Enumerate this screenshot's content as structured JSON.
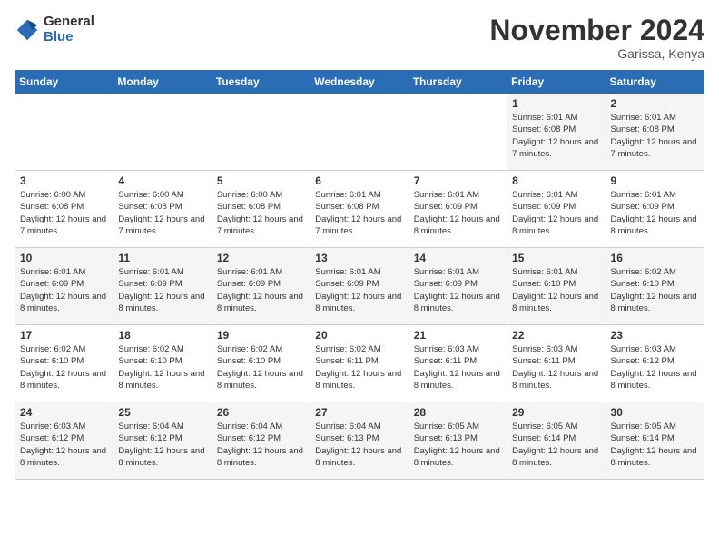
{
  "logo": {
    "general": "General",
    "blue": "Blue"
  },
  "title": "November 2024",
  "location": "Garissa, Kenya",
  "days_of_week": [
    "Sunday",
    "Monday",
    "Tuesday",
    "Wednesday",
    "Thursday",
    "Friday",
    "Saturday"
  ],
  "weeks": [
    [
      {
        "day": "",
        "info": ""
      },
      {
        "day": "",
        "info": ""
      },
      {
        "day": "",
        "info": ""
      },
      {
        "day": "",
        "info": ""
      },
      {
        "day": "",
        "info": ""
      },
      {
        "day": "1",
        "info": "Sunrise: 6:01 AM\nSunset: 6:08 PM\nDaylight: 12 hours and 7 minutes."
      },
      {
        "day": "2",
        "info": "Sunrise: 6:01 AM\nSunset: 6:08 PM\nDaylight: 12 hours and 7 minutes."
      }
    ],
    [
      {
        "day": "3",
        "info": "Sunrise: 6:00 AM\nSunset: 6:08 PM\nDaylight: 12 hours and 7 minutes."
      },
      {
        "day": "4",
        "info": "Sunrise: 6:00 AM\nSunset: 6:08 PM\nDaylight: 12 hours and 7 minutes."
      },
      {
        "day": "5",
        "info": "Sunrise: 6:00 AM\nSunset: 6:08 PM\nDaylight: 12 hours and 7 minutes."
      },
      {
        "day": "6",
        "info": "Sunrise: 6:01 AM\nSunset: 6:08 PM\nDaylight: 12 hours and 7 minutes."
      },
      {
        "day": "7",
        "info": "Sunrise: 6:01 AM\nSunset: 6:09 PM\nDaylight: 12 hours and 8 minutes."
      },
      {
        "day": "8",
        "info": "Sunrise: 6:01 AM\nSunset: 6:09 PM\nDaylight: 12 hours and 8 minutes."
      },
      {
        "day": "9",
        "info": "Sunrise: 6:01 AM\nSunset: 6:09 PM\nDaylight: 12 hours and 8 minutes."
      }
    ],
    [
      {
        "day": "10",
        "info": "Sunrise: 6:01 AM\nSunset: 6:09 PM\nDaylight: 12 hours and 8 minutes."
      },
      {
        "day": "11",
        "info": "Sunrise: 6:01 AM\nSunset: 6:09 PM\nDaylight: 12 hours and 8 minutes."
      },
      {
        "day": "12",
        "info": "Sunrise: 6:01 AM\nSunset: 6:09 PM\nDaylight: 12 hours and 8 minutes."
      },
      {
        "day": "13",
        "info": "Sunrise: 6:01 AM\nSunset: 6:09 PM\nDaylight: 12 hours and 8 minutes."
      },
      {
        "day": "14",
        "info": "Sunrise: 6:01 AM\nSunset: 6:09 PM\nDaylight: 12 hours and 8 minutes."
      },
      {
        "day": "15",
        "info": "Sunrise: 6:01 AM\nSunset: 6:10 PM\nDaylight: 12 hours and 8 minutes."
      },
      {
        "day": "16",
        "info": "Sunrise: 6:02 AM\nSunset: 6:10 PM\nDaylight: 12 hours and 8 minutes."
      }
    ],
    [
      {
        "day": "17",
        "info": "Sunrise: 6:02 AM\nSunset: 6:10 PM\nDaylight: 12 hours and 8 minutes."
      },
      {
        "day": "18",
        "info": "Sunrise: 6:02 AM\nSunset: 6:10 PM\nDaylight: 12 hours and 8 minutes."
      },
      {
        "day": "19",
        "info": "Sunrise: 6:02 AM\nSunset: 6:10 PM\nDaylight: 12 hours and 8 minutes."
      },
      {
        "day": "20",
        "info": "Sunrise: 6:02 AM\nSunset: 6:11 PM\nDaylight: 12 hours and 8 minutes."
      },
      {
        "day": "21",
        "info": "Sunrise: 6:03 AM\nSunset: 6:11 PM\nDaylight: 12 hours and 8 minutes."
      },
      {
        "day": "22",
        "info": "Sunrise: 6:03 AM\nSunset: 6:11 PM\nDaylight: 12 hours and 8 minutes."
      },
      {
        "day": "23",
        "info": "Sunrise: 6:03 AM\nSunset: 6:12 PM\nDaylight: 12 hours and 8 minutes."
      }
    ],
    [
      {
        "day": "24",
        "info": "Sunrise: 6:03 AM\nSunset: 6:12 PM\nDaylight: 12 hours and 8 minutes."
      },
      {
        "day": "25",
        "info": "Sunrise: 6:04 AM\nSunset: 6:12 PM\nDaylight: 12 hours and 8 minutes."
      },
      {
        "day": "26",
        "info": "Sunrise: 6:04 AM\nSunset: 6:12 PM\nDaylight: 12 hours and 8 minutes."
      },
      {
        "day": "27",
        "info": "Sunrise: 6:04 AM\nSunset: 6:13 PM\nDaylight: 12 hours and 8 minutes."
      },
      {
        "day": "28",
        "info": "Sunrise: 6:05 AM\nSunset: 6:13 PM\nDaylight: 12 hours and 8 minutes."
      },
      {
        "day": "29",
        "info": "Sunrise: 6:05 AM\nSunset: 6:14 PM\nDaylight: 12 hours and 8 minutes."
      },
      {
        "day": "30",
        "info": "Sunrise: 6:05 AM\nSunset: 6:14 PM\nDaylight: 12 hours and 8 minutes."
      }
    ]
  ]
}
